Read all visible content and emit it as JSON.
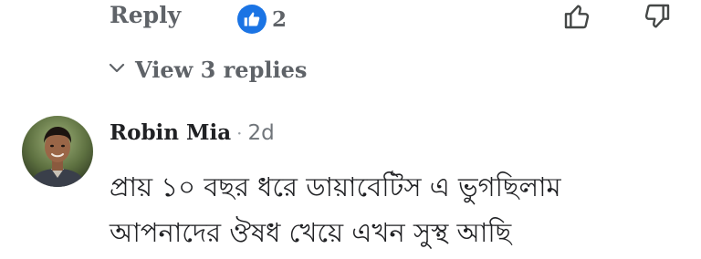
{
  "actions": {
    "reply_label": "Reply",
    "like_count": "2",
    "like_icon": "thumbs-up-icon",
    "thumb_up_icon": "thumb-up-outline-icon",
    "thumb_down_icon": "thumb-down-outline-icon",
    "accent_color": "#1b74e4"
  },
  "replies": {
    "toggle_icon": "chevron-down-icon",
    "view_label": "View 3 replies"
  },
  "comment": {
    "author": "Robin Mia",
    "separator": "·",
    "time": "2d",
    "text_lines": [
      "প্রায় ১০ বছর ধরে ডায়াবেটিস  এ ভুগছিলাম",
      "আপনাদের ঔষধ খেয়ে এখন সুস্থ আছি"
    ]
  }
}
